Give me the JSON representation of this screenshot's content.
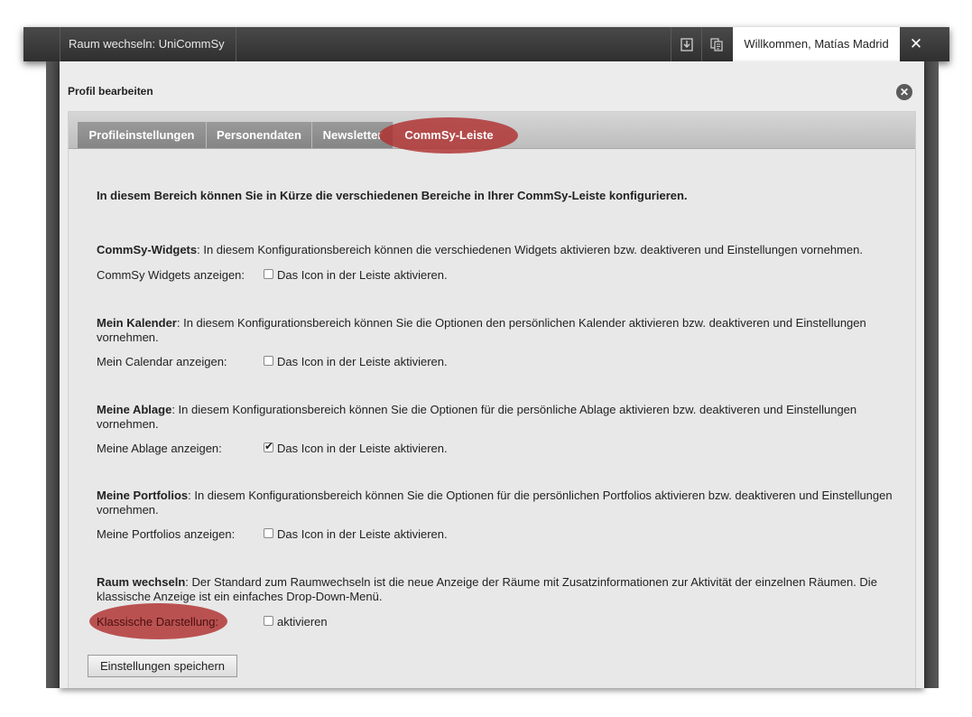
{
  "topbar": {
    "room_switch": "Raum wechseln: UniCommSy",
    "icons": [
      "download-icon",
      "clipboard-icon"
    ],
    "welcome": "Willkommen, Matías Madrid",
    "close": "✕"
  },
  "dialog": {
    "title": "Profil bearbeiten",
    "tabs": [
      {
        "label": "Profileinstellungen"
      },
      {
        "label": "Personendaten"
      },
      {
        "label": "Newsletter"
      },
      {
        "label": "CommSy-Leiste"
      }
    ],
    "active_tab": "CommSy-Leiste",
    "intro": "In diesem Bereich können Sie in Kürze die verschiedenen Bereiche in Ihrer CommSy-Leiste konfigurieren.",
    "sections": [
      {
        "heading": "CommSy-Widgets",
        "text": ": In diesem Konfigurationsbereich können die verschiedenen Widgets aktivieren bzw. deaktiveren und Einstellungen vornehmen.",
        "option_label": "CommSy Widgets anzeigen:",
        "checkbox_label": "Das Icon in der Leiste aktivieren.",
        "checked": false
      },
      {
        "heading": "Mein Kalender",
        "text": ": In diesem Konfigurationsbereich können Sie die Optionen den persönlichen Kalender aktivieren bzw. deaktiveren und Einstellungen vornehmen.",
        "option_label": "Mein Calendar anzeigen:",
        "checkbox_label": "Das Icon in der Leiste aktivieren.",
        "checked": false
      },
      {
        "heading": "Meine Ablage",
        "text": ": In diesem Konfigurationsbereich können Sie die Optionen für die persönliche Ablage aktivieren bzw. deaktiveren und Einstellungen vornehmen.",
        "option_label": "Meine Ablage anzeigen:",
        "checkbox_label": "Das Icon in der Leiste aktivieren.",
        "checked": true
      },
      {
        "heading": "Meine Portfolios",
        "text": ": In diesem Konfigurationsbereich können Sie die Optionen für die persönlichen Portfolios aktivieren bzw. deaktiveren und Einstellungen vornehmen.",
        "option_label": "Meine Portfolios anzeigen:",
        "checkbox_label": "Das Icon in der Leiste aktivieren.",
        "checked": false
      },
      {
        "heading": "Raum wechseln",
        "text": ": Der Standard zum Raumwechseln ist die neue Anzeige der Räume mit Zusatzinformationen zur Aktivität der einzelnen Räumen. Die klassische Anzeige ist ein einfaches Drop-Down-Menü.",
        "option_label": "Klassische Darstellung:",
        "checkbox_label": "aktivieren",
        "checked": false
      }
    ],
    "save_button": "Einstellungen speichern"
  },
  "colors": {
    "highlight": "#b03030",
    "topbar": "#3a3a3a",
    "panel": "#ececec"
  }
}
